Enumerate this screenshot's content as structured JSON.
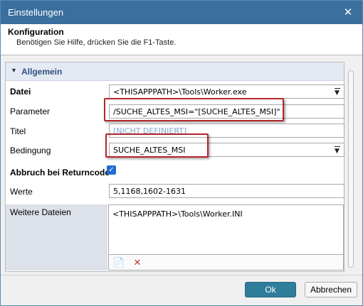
{
  "window": {
    "title": "Einstellungen",
    "close_glyph": "✕"
  },
  "header": {
    "title": "Konfiguration",
    "subtitle": "Benötigen Sie Hilfe, drücken Sie die F1-Taste."
  },
  "group": {
    "label": "Allgemein",
    "icon": "triangle-down-icon",
    "arrow_glyph": "▼"
  },
  "fields": {
    "datei": {
      "label": "Datei",
      "value": "<THISAPPPATH>\\Tools\\Worker.exe"
    },
    "parameter": {
      "label": "Parameter",
      "value": "/SUCHE_ALTES_MSI=\"[SUCHE_ALTES_MSI]\""
    },
    "titel": {
      "label": "Titel",
      "value": "[NICHT DEFINIERT]"
    },
    "bedingung": {
      "label": "Bedingung",
      "value": "SUCHE_ALTES_MSI"
    },
    "abbruch": {
      "label": "Abbruch bei Returncode",
      "checked": true,
      "check_glyph": "✓"
    },
    "werte": {
      "label": "Werte",
      "value": "5,1168,1602-1631"
    },
    "weitere": {
      "label": "Weitere Dateien",
      "items": [
        "<THISAPPPATH>\\Tools\\Worker.INI"
      ]
    }
  },
  "tools": {
    "add_glyph": "📄",
    "remove_glyph": "✕"
  },
  "buttons": {
    "ok": "Ok",
    "cancel": "Abbrechen"
  },
  "colors": {
    "titlebar": "#3a6f9e",
    "highlight": "#b3262c",
    "ok_button": "#2e7d9a",
    "checkbox": "#1e6fd0"
  }
}
